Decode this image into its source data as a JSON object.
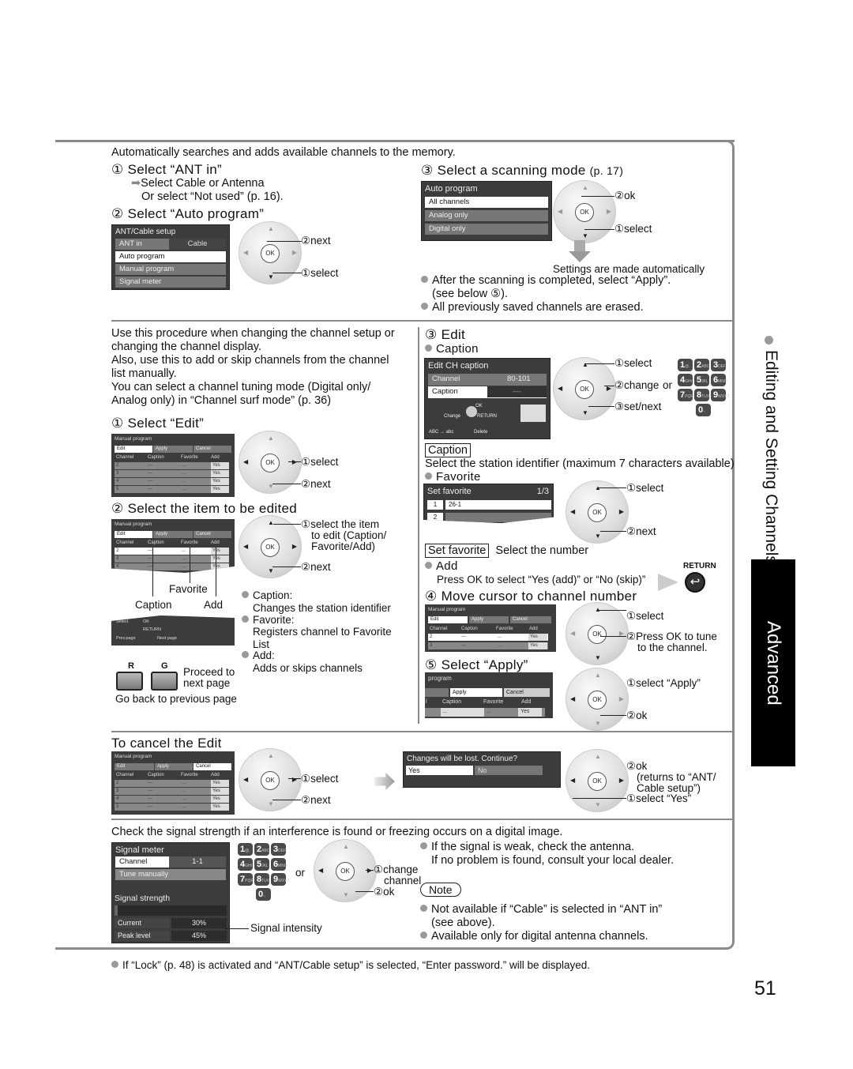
{
  "auto_program": {
    "intro": "Automatically searches and adds available channels to the memory.",
    "step1_title": "Select “ANT in”",
    "step1_sub1": "Select Cable or Antenna",
    "step1_sub2": "Or select “Not used” (p. 16).",
    "step2_title": "Select “Auto program”",
    "ant_screen": {
      "title": "ANT/Cable setup",
      "rows": [
        {
          "label": "ANT in",
          "value": "Cable"
        },
        {
          "label": "Auto program",
          "value": ""
        },
        {
          "label": "Manual program",
          "value": ""
        },
        {
          "label": "Signal meter",
          "value": ""
        }
      ]
    },
    "step2_next": "②next",
    "step2_select": "①select",
    "step3_title": "Select a scanning mode",
    "step3_ref": "(p. 17)",
    "auto_screen": {
      "title": "Auto program",
      "rows": [
        "All channels",
        "Analog only",
        "Digital only"
      ]
    },
    "step3_ok": "②ok",
    "step3_select": "①select",
    "auto_note": "Settings are made automatically",
    "bullets": [
      "After the scanning is completed, select “Apply”.",
      "(see below ⑤).",
      "All previously saved channels are erased."
    ]
  },
  "manual_program": {
    "intro": [
      "Use this procedure when changing the channel setup or",
      "changing the channel display.",
      "Also, use this to add or skip channels from the channel",
      "list manually.",
      "You can select a channel tuning mode (Digital only/",
      "Analog only) in “Channel surf mode” (p. 36)"
    ],
    "step1_title": "Select “Edit”",
    "screen": {
      "title": "Manual program",
      "tabs": [
        "Edit",
        "Apply",
        "Cancel"
      ],
      "headers": [
        "Channel",
        "Caption",
        "Favorite",
        "Add"
      ],
      "rows": [
        {
          "channel": "2",
          "caption": "---",
          "favorite": "...",
          "add": "Yes"
        },
        {
          "channel": "3",
          "caption": "---",
          "favorite": "...",
          "add": "Yes"
        },
        {
          "channel": "4",
          "caption": "---",
          "favorite": "...",
          "add": "Yes"
        },
        {
          "channel": "5",
          "caption": "---",
          "favorite": "...",
          "add": "Yes"
        }
      ],
      "footer_select": "Select",
      "footer_ok": "OK",
      "footer_return": "RETURN",
      "footer_prev": "Prev.page",
      "footer_next": "Next page"
    },
    "step1_select": "①select",
    "step1_next": "②next",
    "step2_title": "Select the item to be edited",
    "step2_select": "①select the item",
    "step2_select2": "to edit (Caption/",
    "step2_select3": "Favorite/Add)",
    "step2_next": "②next",
    "label_favorite": "Favorite",
    "label_caption": "Caption",
    "label_add": "Add",
    "items": [
      {
        "title": "Caption:",
        "desc": "Changes the station identifier"
      },
      {
        "title": "Favorite:",
        "desc": "Registers channel to Favorite List"
      },
      {
        "title": "Add:",
        "desc": "Adds or skips channels"
      }
    ],
    "btn_r": "R",
    "btn_g": "G",
    "proceed": "Proceed to",
    "proceed2": "next page",
    "go_back": "Go back to previous page",
    "step3_title": "Edit",
    "caption_head": "Caption",
    "caption_screen": {
      "title": "Edit CH caption",
      "channel_label": "Channel",
      "channel_value": "80-101",
      "caption_label": "Caption",
      "caption_value": "----",
      "change": "Change",
      "ok": "OK",
      "return": "RETURN",
      "abc": "ABC → abc",
      "delete": "Delete"
    },
    "cap_select": "①select",
    "cap_change": "②change",
    "cap_or": "or",
    "cap_setnext": "③set/next",
    "keypad": [
      {
        "n": "1",
        "s": "@."
      },
      {
        "n": "2",
        "s": "ABC"
      },
      {
        "n": "3",
        "s": "DEF"
      },
      {
        "n": "4",
        "s": "GHI"
      },
      {
        "n": "5",
        "s": "JKL"
      },
      {
        "n": "6",
        "s": "MNO"
      },
      {
        "n": "7",
        "s": "PQRS"
      },
      {
        "n": "8",
        "s": "TUV"
      },
      {
        "n": "9",
        "s": "WXYZ"
      },
      {
        "n": "0",
        "s": "-."
      }
    ],
    "caption_box": "Caption",
    "caption_desc": "Select the station identifier (maximum 7 characters available)",
    "favorite_head": "Favorite",
    "fav_screen": {
      "title": "Set favorite",
      "page": "1/3",
      "rows": [
        {
          "num": "1",
          "value": "26-1"
        },
        {
          "num": "2",
          "value": ""
        }
      ]
    },
    "fav_select": "①select",
    "fav_next": "②next",
    "fav_box": "Set favorite",
    "fav_desc": "Select the number",
    "add_head": "Add",
    "add_desc": "Press OK to select “Yes (add)” or “No (skip)”",
    "return_label": "RETURN",
    "step4_title": "Move cursor to channel number",
    "step4_select": "①select",
    "step4_press": "②Press OK to tune",
    "step4_press2": "to the channel.",
    "step5_title": "Select “Apply”",
    "step5_screen": {
      "title": "program",
      "tabs": [
        "",
        "Apply",
        "Cancel"
      ],
      "headers": [
        "l",
        "Caption",
        "Favorite",
        "Add"
      ],
      "row": {
        "caption": "...",
        "favorite": "...",
        "add": "Yes"
      }
    },
    "step5_select": "①select “Apply”",
    "step5_ok": "②ok"
  },
  "cancel_edit": {
    "title": "To cancel the Edit",
    "select": "①select",
    "next": "②next",
    "dialog": {
      "title": "Changes will be lost. Continue?",
      "yes": "Yes",
      "no": "No"
    },
    "ok": "②ok",
    "ok2": "(returns to “ANT/",
    "ok3": "Cable setup”)",
    "select_yes": "①select “Yes”"
  },
  "signal_meter": {
    "intro": "Check the signal strength if an interference is found or freezing occurs on a digital image.",
    "screen": {
      "title": "Signal  meter",
      "channel_label": "Channel",
      "channel_value": "1-1",
      "tune": "Tune manually",
      "strength": "Signal  strength",
      "current_label": "Current",
      "current_value": "30%",
      "peak_label": "Peak level",
      "peak_value": "45%",
      "strength_fraction": 0.03
    },
    "or": "or",
    "change": "①change",
    "change2": "channel",
    "ok": "②ok",
    "intensity": "Signal intensity",
    "bullet1": "If the signal is weak, check the antenna.",
    "bullet1b": "If no problem is found, consult your local dealer.",
    "note": "Note",
    "note1": "Not available if “Cable” is selected in “ANT in”",
    "note1b": "(see above).",
    "note2": "Available only for digital antenna channels."
  },
  "side": {
    "section": "Editing and Setting Channels",
    "tab": "Advanced"
  },
  "footer": {
    "note": "If “Lock” (p. 48) is activated and “ANT/Cable setup” is selected, “Enter password.” will be displayed.",
    "page": "51"
  },
  "nums": {
    "c1": "①",
    "c2": "②",
    "c3": "③",
    "c4": "④",
    "c5": "⑤"
  }
}
